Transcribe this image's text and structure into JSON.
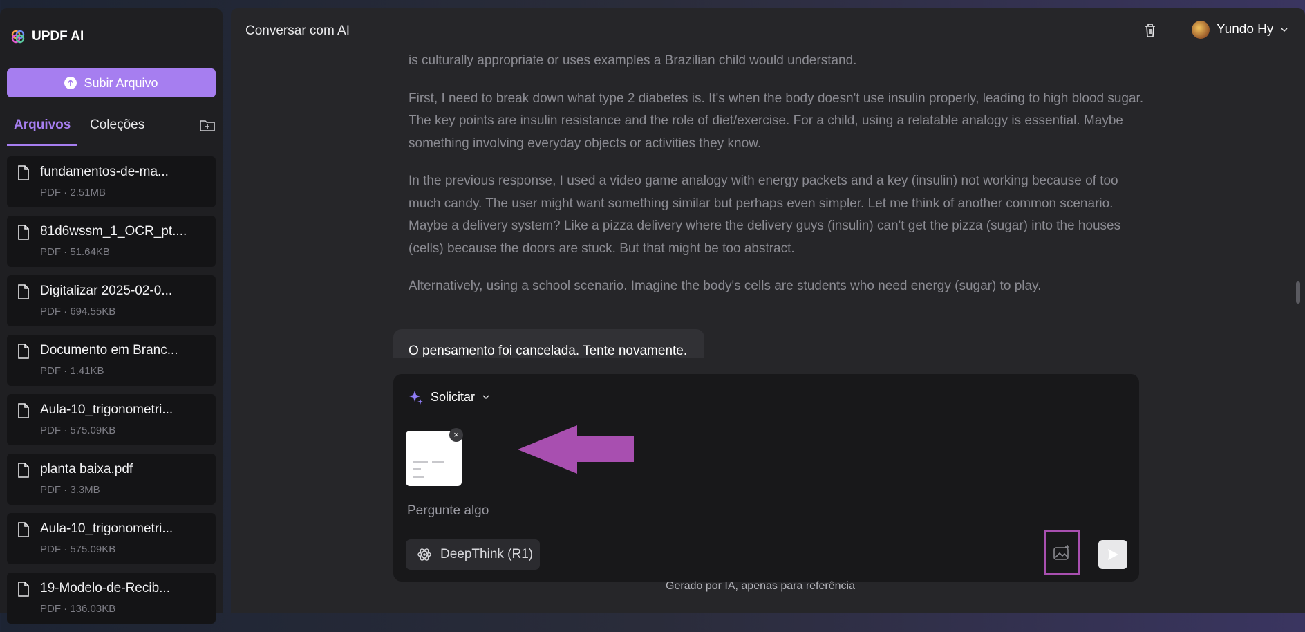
{
  "app": {
    "name": "UPDF AI"
  },
  "sidebar": {
    "upload_label": "Subir Arquivo",
    "tabs": [
      {
        "label": "Arquivos",
        "active": true
      },
      {
        "label": "Coleções",
        "active": false
      }
    ],
    "files": [
      {
        "name": "fundamentos-de-ma...",
        "meta": "PDF · 2.51MB"
      },
      {
        "name": "81d6wssm_1_OCR_pt....",
        "meta": "PDF · 51.64KB"
      },
      {
        "name": "Digitalizar 2025-02-0...",
        "meta": "PDF · 694.55KB"
      },
      {
        "name": "Documento em Branc...",
        "meta": "PDF · 1.41KB"
      },
      {
        "name": "Aula-10_trigonometri...",
        "meta": "PDF · 575.09KB"
      },
      {
        "name": "planta baixa.pdf",
        "meta": "PDF · 3.3MB"
      },
      {
        "name": "Aula-10_trigonometri...",
        "meta": "PDF · 575.09KB"
      },
      {
        "name": "19-Modelo-de-Recib...",
        "meta": "PDF · 136.03KB"
      }
    ]
  },
  "main": {
    "title": "Conversar com AI",
    "user": {
      "name": "Yundo Hy"
    },
    "thought": [
      "is culturally appropriate or uses examples a Brazilian child would understand.",
      "First, I need to break down what type 2 diabetes is. It's when the body doesn't use insulin properly, leading to high blood sugar. The key points are insulin resistance and the role of diet/exercise. For a child, using a relatable analogy is essential. Maybe something involving everyday objects or activities they know.",
      "In the previous response, I used a video game analogy with energy packets and a key (insulin) not working because of too much candy. The user might want something similar but perhaps even simpler. Let me think of another common scenario. Maybe a delivery system? Like a pizza delivery where the delivery guys (insulin) can't get the pizza (sugar) into the houses (cells) because the doors are stuck. But that might be too abstract.",
      "Alternatively, using a school scenario. Imagine the body's cells are students who need energy (sugar) to play."
    ],
    "cancel_notice": "O pensamento foi cancelada. Tente novamente.",
    "composer": {
      "mode_label": "Solicitar",
      "placeholder": "Pergunte algo",
      "deepthink_label": "DeepThink (R1)",
      "attachment_close": "×"
    },
    "footer_note": "Gerado por IA, apenas para referência"
  },
  "colors": {
    "accent": "#a67ef0",
    "annotation": "#a84fb0"
  }
}
